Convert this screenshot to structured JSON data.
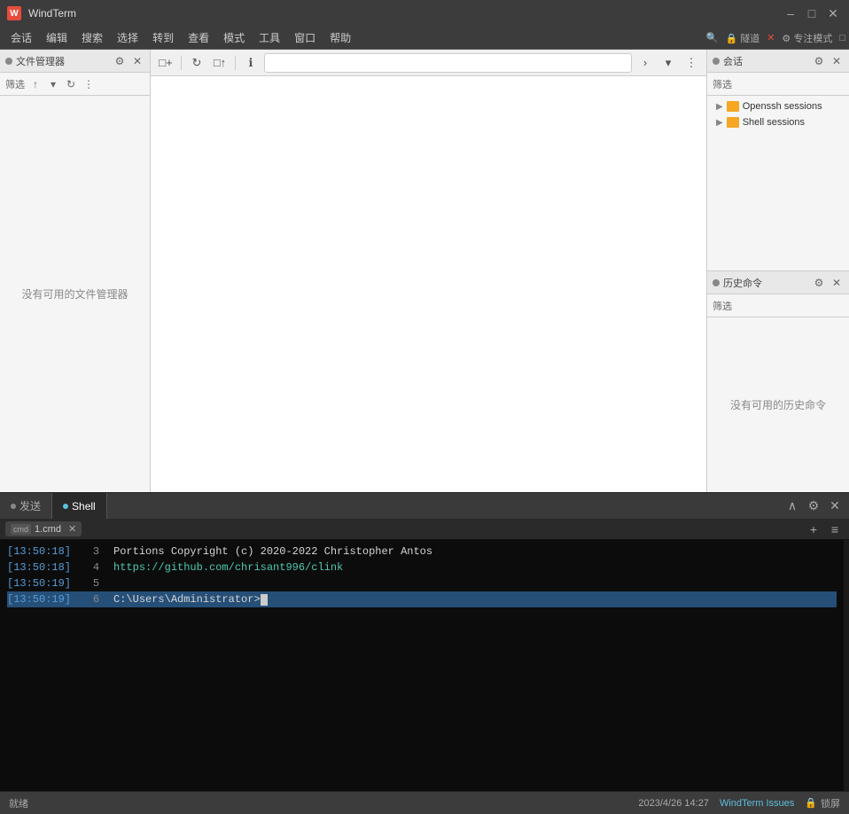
{
  "titleBar": {
    "appName": "WindTerm",
    "iconText": "W",
    "minimizeLabel": "–",
    "maximizeLabel": "□",
    "closeLabel": "✕"
  },
  "menuBar": {
    "items": [
      "会话",
      "编辑",
      "搜索",
      "选择",
      "转到",
      "查看",
      "模式",
      "工具",
      "窗口",
      "帮助"
    ],
    "rightItems": [
      {
        "label": "🔍",
        "name": "search"
      },
      {
        "label": "🔒 隧道",
        "name": "tunnel"
      },
      {
        "label": "✕",
        "name": "x-btn"
      },
      {
        "label": "⚙ 专注模式",
        "name": "focus-mode"
      },
      {
        "label": "□",
        "name": "pin"
      }
    ]
  },
  "fileManager": {
    "panelTitle": "文件管理器",
    "filterLabel": "筛选",
    "emptyText": "没有可用的文件管理器",
    "settingsTooltip": "设置",
    "closeTooltip": "关闭"
  },
  "centerPanel": {
    "addressPlaceholder": "|"
  },
  "sessions": {
    "panelTitle": "会话",
    "filterLabel": "筛选",
    "items": [
      {
        "label": "Openssh sessions",
        "type": "openssh"
      },
      {
        "label": "Shell sessions",
        "type": "shell"
      }
    ]
  },
  "history": {
    "panelTitle": "历史命令",
    "filterLabel": "筛选",
    "emptyText": "没有可用的历史命令"
  },
  "bottomTabs": {
    "tabs": [
      {
        "label": "发送",
        "active": false,
        "dotActive": false
      },
      {
        "label": "Shell",
        "active": true,
        "dotActive": true
      }
    ],
    "rightButtons": [
      "∧",
      "⚙",
      "✕"
    ]
  },
  "terminal": {
    "subTab": "1.cmd",
    "lines": [
      {
        "ts": "[13:50:18]",
        "ln": "3",
        "text": "Portions Copyright (c) 2020-2022 Christopher Antos",
        "type": "normal"
      },
      {
        "ts": "[13:50:18]",
        "ln": "4",
        "text": "https://github.com/chrisant996/clink",
        "type": "link"
      },
      {
        "ts": "[13:50:19]",
        "ln": "5",
        "text": "",
        "type": "normal"
      },
      {
        "ts": "[13:50:19]",
        "ln": "6",
        "text": "C:\\Users\\Administrator>",
        "type": "prompt"
      }
    ]
  },
  "statusBar": {
    "leftText": "就绪",
    "datetime": "2023/4/26 14:27",
    "issuesLink": "WindTerm Issues",
    "lockText": "锁屏"
  }
}
